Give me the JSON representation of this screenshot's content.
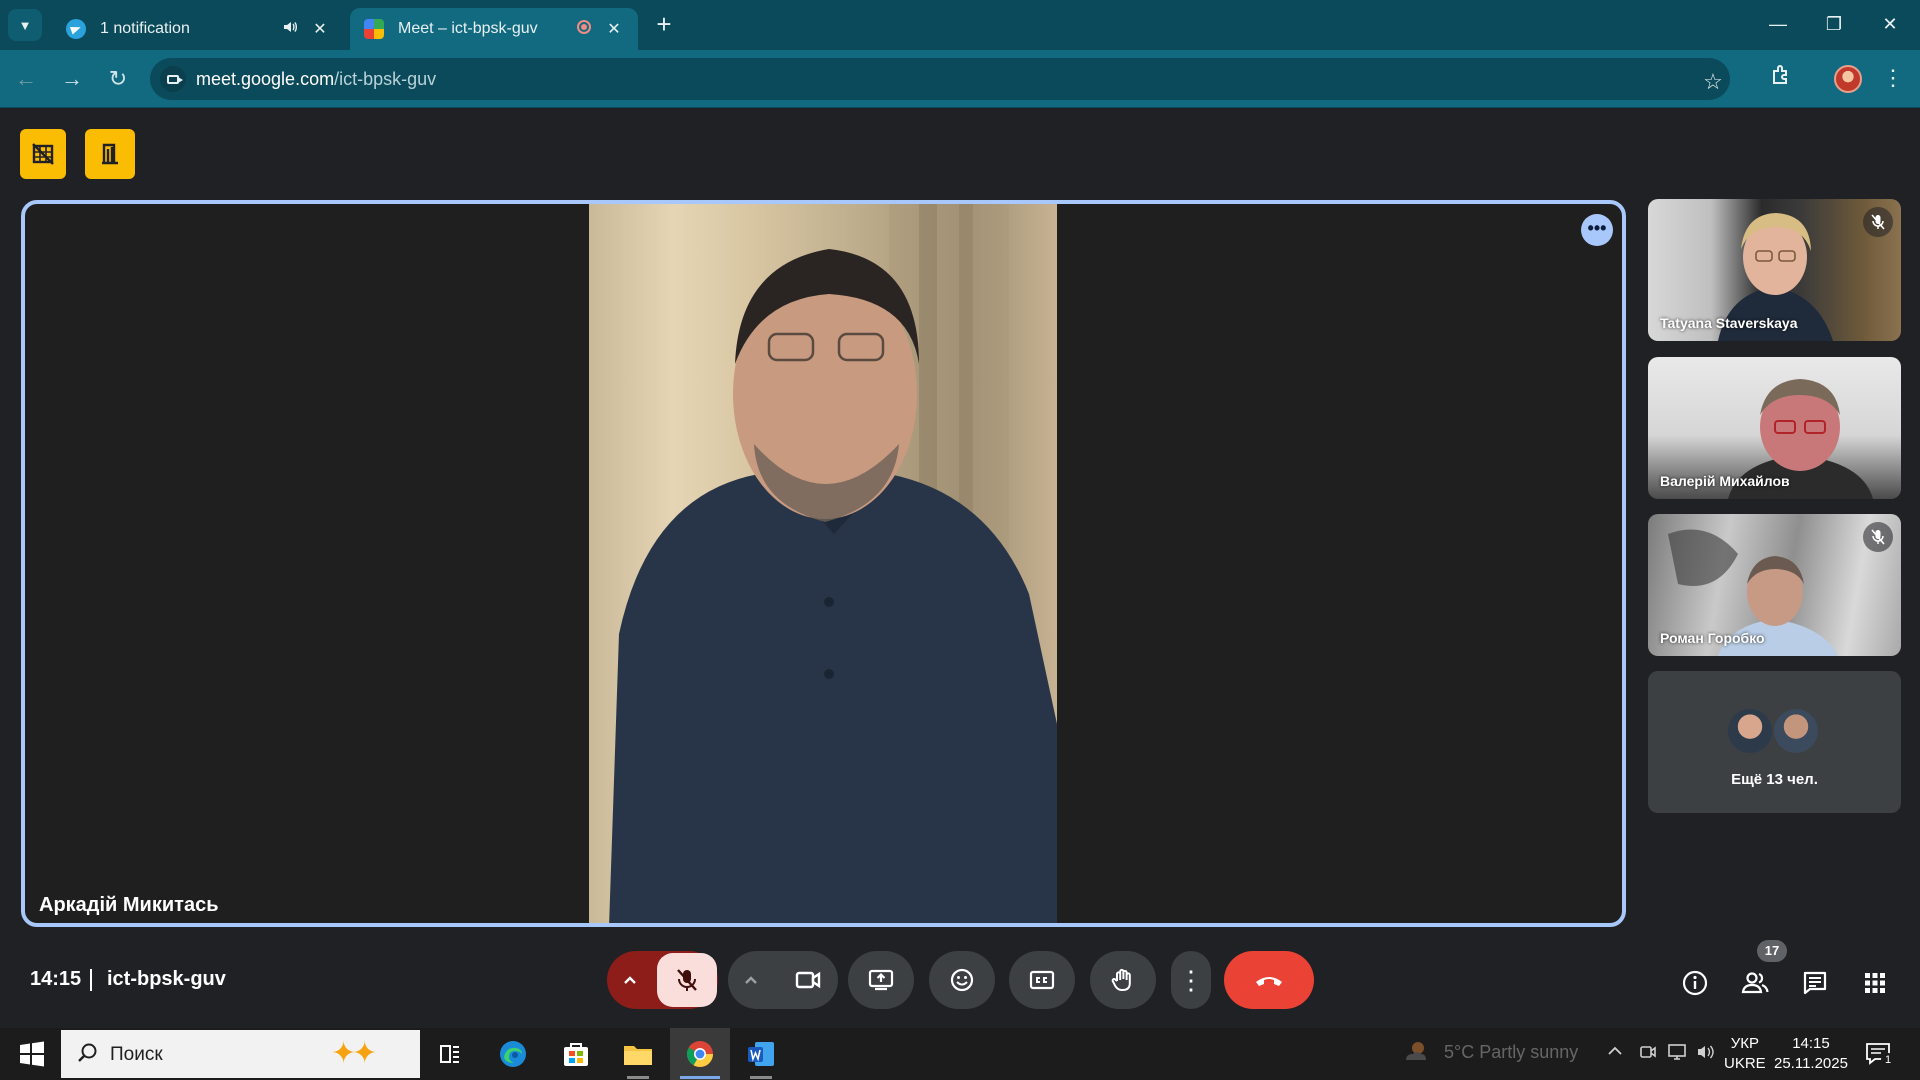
{
  "browser": {
    "tabs": [
      {
        "title": "1 notification",
        "extra_icon": "speaker-icon"
      },
      {
        "title": "Meet – ict-bpsk-guv",
        "extra_icon": "recording-icon"
      }
    ],
    "url_host": "meet.google.com",
    "url_path": "/ict-bpsk-guv",
    "theme_color": "#126a80"
  },
  "meet": {
    "main_speaker": "Аркадій Микитась",
    "participants": [
      {
        "name": "Tatyana Staverskaya",
        "muted": true
      },
      {
        "name": "Валерій Михайлов",
        "muted": false
      },
      {
        "name": "Роман Горобко",
        "muted": true
      }
    ],
    "more_participants_label": "Ещё 13 чел.",
    "time": "14:15",
    "meeting_code": "ict-bpsk-guv",
    "participant_count": "17",
    "accent": "#a8c7fa",
    "hangup_color": "#ea4335"
  },
  "taskbar": {
    "search_placeholder": "Поиск",
    "weather": "5°C  Partly sunny",
    "lang_top": "УКР",
    "lang_bottom": "UKRE",
    "clock_time": "14:15",
    "clock_date": "25.11.2025",
    "notification_count": "1"
  }
}
